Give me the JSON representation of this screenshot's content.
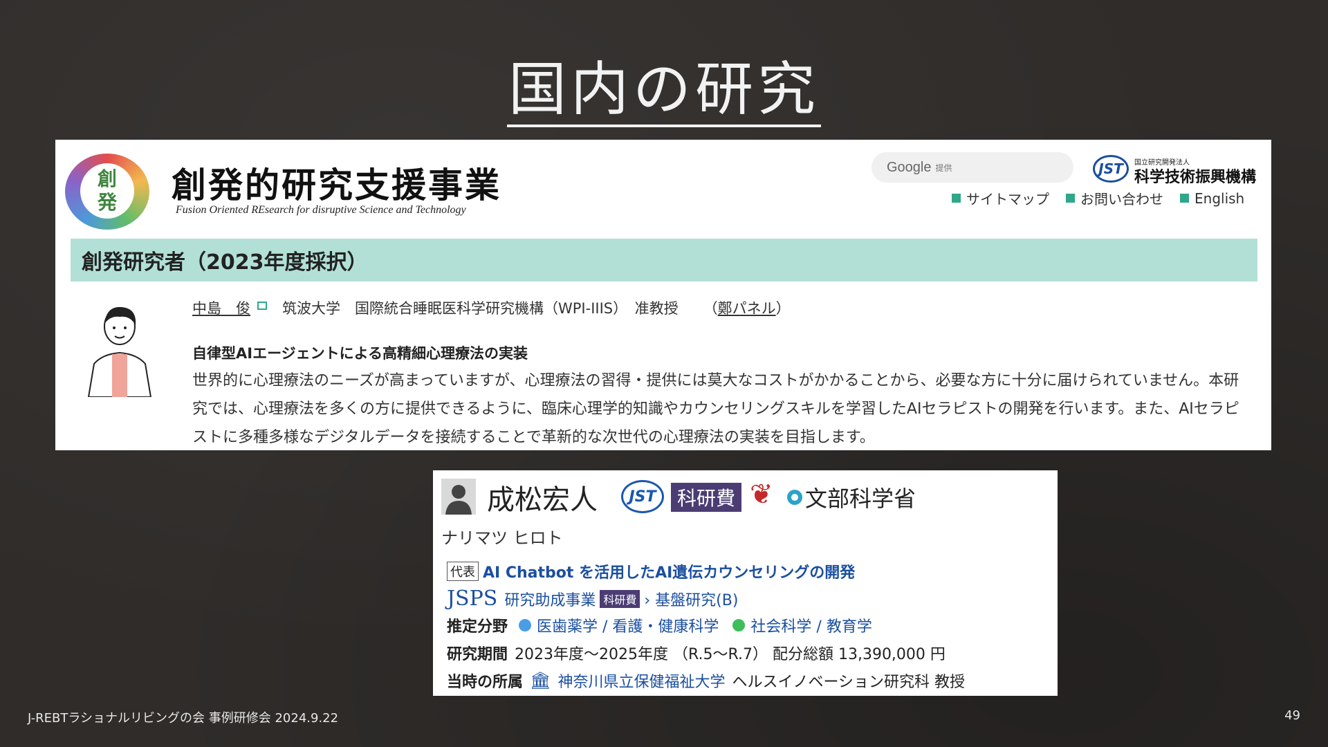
{
  "slide": {
    "title": "国内の研究",
    "footer": "J-REBTラショナルリビングの会 事例研修会 2024.9.22",
    "page_number": "49"
  },
  "panel1": {
    "logo_text_top": "創",
    "logo_text_bottom": "発",
    "brand_jp": "創発的研究支援事業",
    "brand_en": "Fusion Oriented REsearch for disruptive Science and Technology",
    "search": {
      "brand": "Google",
      "suffix": "提供"
    },
    "jst": {
      "mark": "JST",
      "small": "国立研究開発法人",
      "name": "科学技術振興機構"
    },
    "links": [
      {
        "label": "サイトマップ"
      },
      {
        "label": "お問い合わせ"
      },
      {
        "label": "English"
      }
    ],
    "band_title": "創発研究者（2023年度採択）",
    "researcher": {
      "name": "中島　俊",
      "affiliation": "筑波大学　国際統合睡眠医科学研究機構（WPI-IIIS）　准教授",
      "panel_open": "（",
      "panel_link": "鄭パネル",
      "panel_close": "）"
    },
    "project_title": "自律型AIエージェントによる高精細心理療法の実装",
    "project_desc": "世界的に心理療法のニーズが高まっていますが、心理療法の習得・提供には莫大なコストがかかることから、必要な方に十分に届けられていません。本研究では、心理療法を多くの方に提供できるように、臨床心理学的知識やカウンセリングスキルを学習したAIセラピストの開発を行います。また、AIセラピストに多種多様なデジタルデータを接続することで革新的な次世代の心理療法の実装を目指します。"
  },
  "panel2": {
    "name": "成松宏人",
    "badge_jst": "JST",
    "badge_kaken": "科研費",
    "badge_mext": "文部科学省",
    "kana": "ナリマツ ヒロト",
    "tag_rep": "代表",
    "project": "AI Chatbot を活用したAI遺伝カウンセリングの開発",
    "jsps": "JSPS",
    "program": "研究助成事業",
    "mini_kaken": "科研費",
    "program_type": "› 基盤研究(B)",
    "field_label": "推定分野",
    "field1": "医歯薬学 / 看護・健康科学",
    "field2": "社会科学 / 教育学",
    "field1_color": "#4a9de6",
    "field2_color": "#3cbf5a",
    "period_label": "研究期間",
    "period": "2023年度～2025年度 （R.5～R.7） 配分総額 13,390,000 円",
    "affil_label": "当時の所属",
    "affil_link": "神奈川県立保健福祉大学",
    "affil_rest": "ヘルスイノベーション研究科 教授"
  }
}
